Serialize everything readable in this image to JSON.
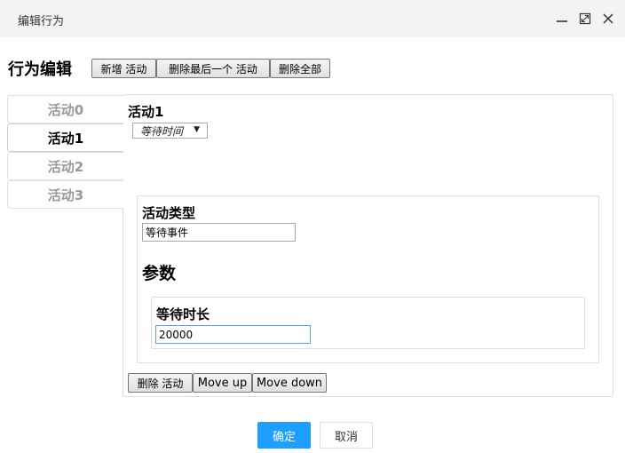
{
  "window": {
    "title": "编辑行为",
    "controls": [
      "minimize-icon",
      "maximize-icon",
      "close-icon"
    ]
  },
  "header": {
    "title": "行为编辑",
    "add_label": "新增 活动",
    "delete_last_label": "删除最后一个 活动",
    "delete_all_label": "删除全部"
  },
  "tabs": [
    {
      "label": "活动0",
      "active": false
    },
    {
      "label": "活动1",
      "active": true
    },
    {
      "label": "活动2",
      "active": false
    },
    {
      "label": "活动3",
      "active": false
    }
  ],
  "activity": {
    "title": "活动1",
    "select_value": "等待时间",
    "type_label": "活动类型",
    "type_value": "等待事件",
    "params_heading": "参数",
    "duration_label": "等待时长",
    "duration_value": "20000"
  },
  "actions": {
    "delete_label": "删除 活动",
    "move_up_label": "Move up",
    "move_down_label": "Move down"
  },
  "footer": {
    "ok_label": "确定",
    "cancel_label": "取消"
  },
  "colors": {
    "primary": "#1e9fff",
    "titlebar": "#f3f3f3"
  }
}
